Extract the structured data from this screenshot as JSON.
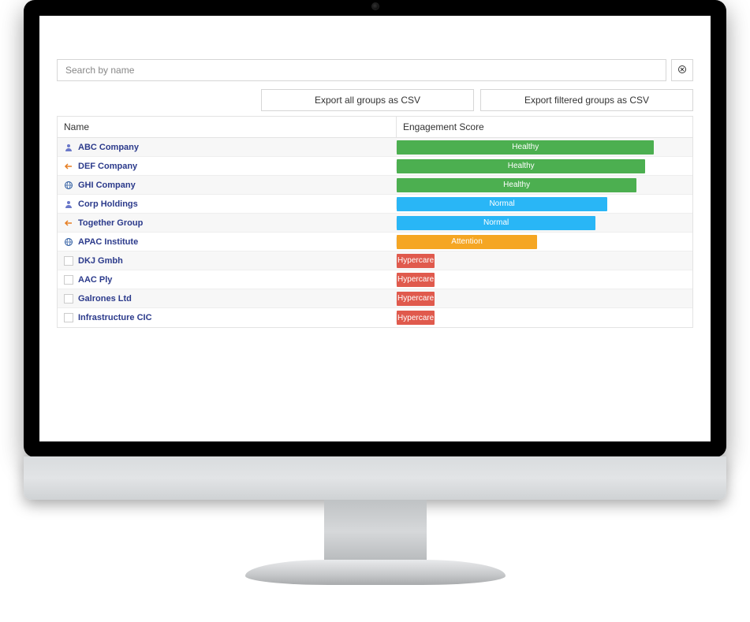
{
  "search": {
    "placeholder": "Search by name"
  },
  "buttons": {
    "export_all": "Export all groups as CSV",
    "export_filtered": "Export filtered groups as CSV"
  },
  "columns": {
    "name": "Name",
    "score": "Engagement Score"
  },
  "colors": {
    "healthy": "#4caf50",
    "normal": "#29b6f6",
    "attention": "#f5a623",
    "hypercare": "#e05a4d"
  },
  "rows": [
    {
      "name": "ABC Company",
      "icon": "user",
      "label": "Healthy",
      "colorKey": "healthy",
      "widthPct": 88
    },
    {
      "name": "DEF Company",
      "icon": "arrow",
      "label": "Healthy",
      "colorKey": "healthy",
      "widthPct": 85
    },
    {
      "name": "GHI Company",
      "icon": "globe",
      "label": "Healthy",
      "colorKey": "healthy",
      "widthPct": 82
    },
    {
      "name": "Corp Holdings",
      "icon": "user",
      "label": "Normal",
      "colorKey": "normal",
      "widthPct": 72
    },
    {
      "name": "Together Group",
      "icon": "arrow",
      "label": "Normal",
      "colorKey": "normal",
      "widthPct": 68
    },
    {
      "name": "APAC Institute",
      "icon": "globe",
      "label": "Attention",
      "colorKey": "attention",
      "widthPct": 48
    },
    {
      "name": "DKJ Gmbh",
      "icon": "checkbox",
      "label": "Hypercare",
      "colorKey": "hypercare",
      "widthPct": 13
    },
    {
      "name": "AAC Ply",
      "icon": "checkbox",
      "label": "Hypercare",
      "colorKey": "hypercare",
      "widthPct": 13
    },
    {
      "name": "Galrones Ltd",
      "icon": "checkbox",
      "label": "Hypercare",
      "colorKey": "hypercare",
      "widthPct": 13
    },
    {
      "name": "Infrastructure CIC",
      "icon": "checkbox",
      "label": "Hypercare",
      "colorKey": "hypercare",
      "widthPct": 13
    }
  ]
}
